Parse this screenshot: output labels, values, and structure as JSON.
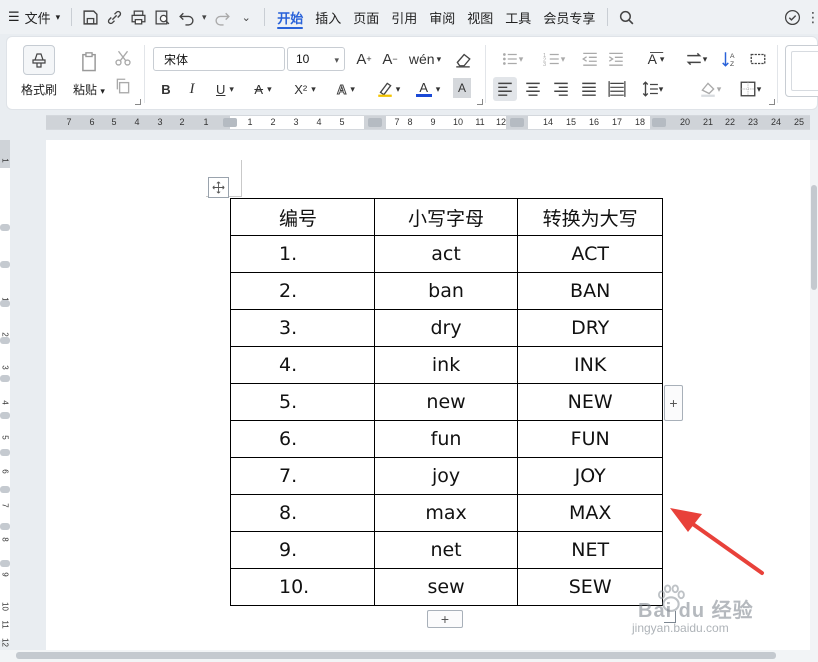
{
  "menubar": {
    "menu_label": "文件",
    "tabs": [
      "开始",
      "插入",
      "页面",
      "引用",
      "审阅",
      "视图",
      "工具",
      "会员专享"
    ]
  },
  "ribbon": {
    "format_painter": "格式刷",
    "paste": "粘贴",
    "font_name": "宋体",
    "font_size": "10",
    "bold": "B",
    "italic": "I",
    "underline": "U",
    "strike": "A",
    "superscript": "X²",
    "text_effect": "A",
    "highlight": "A",
    "font_color": "A",
    "char_shade": "A",
    "font_color_hex": "#1a49d6",
    "highlight_hex": "#f4c400"
  },
  "ruler": {
    "labels": [
      "7",
      "6",
      "5",
      "4",
      "3",
      "2",
      "1",
      "1",
      "2",
      "3",
      "4",
      "5",
      "7",
      "8",
      "9",
      "10",
      "11",
      "12",
      "14",
      "15",
      "16",
      "17",
      "18",
      "20",
      "21",
      "22",
      "23",
      "24",
      "25"
    ]
  },
  "vruler": {
    "labels": [
      "1",
      "1",
      "2",
      "3",
      "4",
      "5",
      "6",
      "7",
      "8",
      "9",
      "10",
      "11",
      "12"
    ]
  },
  "table": {
    "headers": [
      "编号",
      "小写字母",
      "转换为大写"
    ],
    "rows": [
      [
        "1.",
        "act",
        "ACT"
      ],
      [
        "2.",
        "ban",
        "BAN"
      ],
      [
        "3.",
        "dry",
        "DRY"
      ],
      [
        "4.",
        "ink",
        "INK"
      ],
      [
        "5.",
        "new",
        "NEW"
      ],
      [
        "6.",
        "fun",
        "FUN"
      ],
      [
        "7.",
        "joy",
        "JOY"
      ],
      [
        "8.",
        "max",
        "MAX"
      ],
      [
        "9.",
        "net",
        "NET"
      ],
      [
        "10.",
        "sew",
        "SEW"
      ]
    ]
  },
  "table_controls": {
    "add_col": "+",
    "add_row": "+"
  },
  "watermark": {
    "brand": "Bai du 经验",
    "url": "jingyan.baidu.com"
  },
  "colors": {
    "accent": "#2962d9",
    "annotation_arrow": "#e8413a"
  }
}
